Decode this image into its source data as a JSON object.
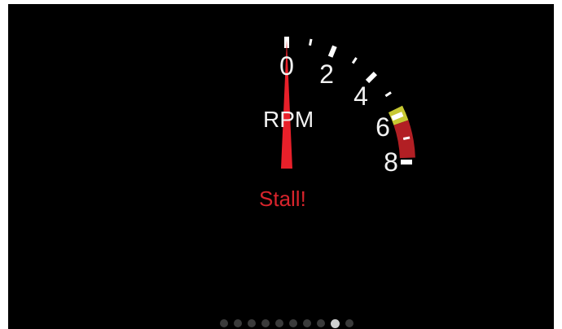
{
  "gauge": {
    "title": "RPM",
    "tick_labels": [
      "0",
      "2",
      "4",
      "6",
      "8"
    ],
    "status_text": "Stall!",
    "reading": 0,
    "colors": {
      "tick": "#ffffff",
      "needle": "#e8202a",
      "warning_zone": "#c7c832",
      "redline_zone": "#b21f24",
      "status": "#d8242c"
    }
  },
  "pager": {
    "page_count": 10,
    "active_page": 9
  }
}
